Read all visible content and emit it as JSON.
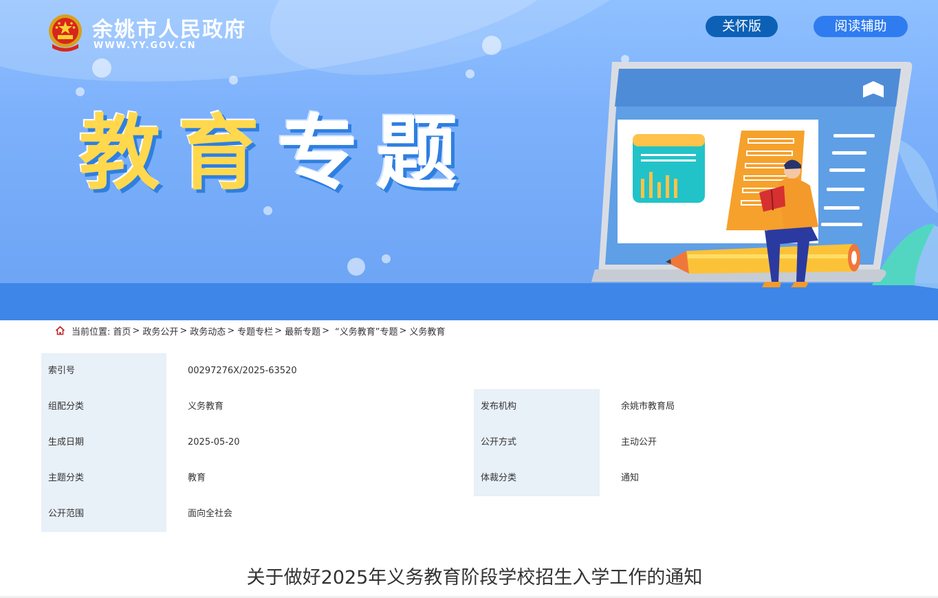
{
  "header": {
    "site_name": "余姚市人民政府",
    "site_url": "WWW.YY.GOV.CN",
    "care_button": "关怀版",
    "reading_button": "阅读辅助"
  },
  "banner": {
    "title_chars": [
      "教",
      "育",
      "专",
      "题"
    ]
  },
  "breadcrumb": {
    "prefix": "当前位置:",
    "items": [
      "首页",
      "政务公开",
      "政务动态",
      "专题专栏",
      "最新专题",
      "“义务教育”专题",
      "义务教育"
    ],
    "separator": ">"
  },
  "meta": {
    "index_no_label": "索引号",
    "index_no_value": "00297276X/2025-63520",
    "category_label": "组配分类",
    "category_value": "义务教育",
    "publisher_label": "发布机构",
    "publisher_value": "余姚市教育局",
    "date_label": "生成日期",
    "date_value": "2025-05-20",
    "disclosure_label": "公开方式",
    "disclosure_value": "主动公开",
    "topic_label": "主题分类",
    "topic_value": "教育",
    "genre_label": "体裁分类",
    "genre_value": "通知",
    "scope_label": "公开范围",
    "scope_value": "面向全社会"
  },
  "article": {
    "title": "关于做好2025年义务教育阶段学校招生入学工作的通知"
  },
  "colors": {
    "banner_bg": "#7db1fb",
    "care_button": "#0c61b6",
    "reading_button": "#2f7cf0",
    "label_bg": "#e8f0f8"
  }
}
